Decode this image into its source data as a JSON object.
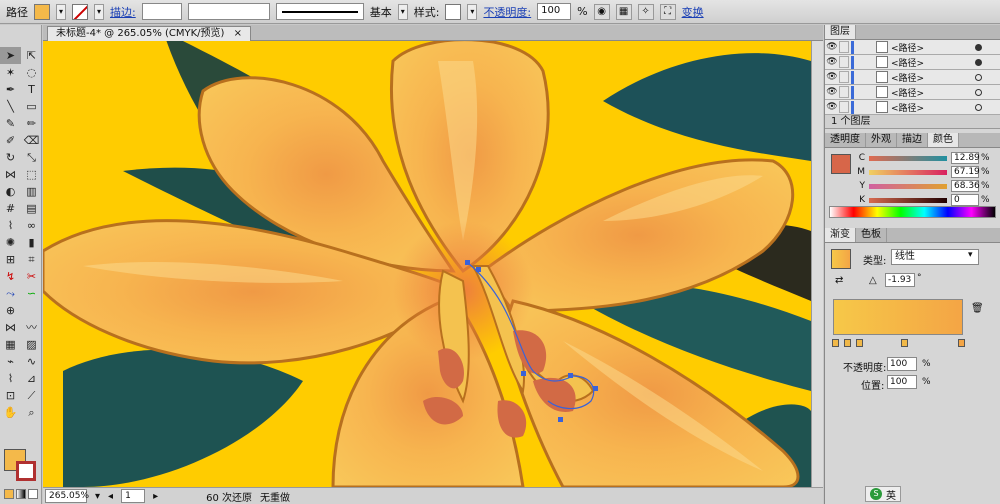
{
  "control_bar": {
    "object_type": "路径",
    "stroke_label": "描边:",
    "stroke_profile": "基本",
    "style_label": "样式:",
    "opacity_label": "不透明度:",
    "opacity_value": "100",
    "opacity_unit": "%",
    "transform_label": "变换",
    "fill_color": "#f4b94a"
  },
  "document": {
    "tab_title": "未标题-4* @ 265.05% (CMYK/预览)"
  },
  "status_bar": {
    "zoom": "265.05%",
    "page": "1",
    "undo_text": "60 次还原",
    "redo_text": "无重做"
  },
  "layers_panel": {
    "tab": "图层",
    "rows": [
      {
        "label": "<路径>",
        "target": "filled"
      },
      {
        "label": "<路径>",
        "target": "filled"
      },
      {
        "label": "<路径>",
        "target": "open"
      },
      {
        "label": "<路径>",
        "target": "open"
      },
      {
        "label": "<路径>",
        "target": "open"
      }
    ],
    "footer": "1 个图层"
  },
  "color_panel": {
    "tabs": [
      "透明度",
      "外观",
      "描边",
      "颜色"
    ],
    "active_tab": "颜色",
    "swatch": "#d76649",
    "channels": [
      {
        "name": "C",
        "value": "12.89"
      },
      {
        "name": "M",
        "value": "67.19"
      },
      {
        "name": "Y",
        "value": "68.36"
      },
      {
        "name": "K",
        "value": "0"
      }
    ],
    "unit": "%"
  },
  "gradient_panel": {
    "tabs": [
      "渐变",
      "色板"
    ],
    "active_tab": "渐变",
    "type_label": "类型:",
    "type_value": "线性",
    "angle_value": "-1.93",
    "angle_unit": "°",
    "opacity_label": "不透明度:",
    "opacity_value": "100",
    "location_label": "位置:",
    "location_value": "100",
    "unit": "%",
    "gradient_start": "#f6c848",
    "gradient_end": "#f4a545"
  },
  "taskbar": {
    "ime_label": "英"
  }
}
